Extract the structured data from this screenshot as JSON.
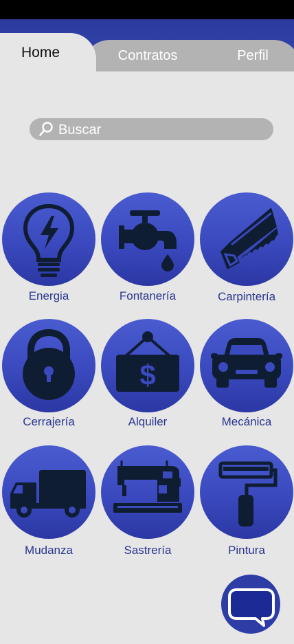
{
  "tabs": [
    {
      "label": "Home",
      "active": true
    },
    {
      "label": "Contratos",
      "active": false
    },
    {
      "label": "Perfil",
      "active": false
    }
  ],
  "search": {
    "placeholder": "Buscar",
    "icon": "search-icon"
  },
  "categories": [
    {
      "label": "Energia",
      "icon": "lightbulb-icon"
    },
    {
      "label": "Fontanería",
      "icon": "faucet-icon"
    },
    {
      "label": "Carpintería",
      "icon": "saw-icon"
    },
    {
      "label": "Cerrajería",
      "icon": "padlock-icon"
    },
    {
      "label": "Alquiler",
      "icon": "rent-sign-icon"
    },
    {
      "label": "Mecánica",
      "icon": "car-icon"
    },
    {
      "label": "Mudanza",
      "icon": "truck-icon"
    },
    {
      "label": "Sastrería",
      "icon": "sewing-machine-icon"
    },
    {
      "label": "Pintura",
      "icon": "paint-roller-icon"
    }
  ],
  "chat": {
    "icon": "chat-bubble-icon"
  },
  "colors": {
    "accent": "#3546b1",
    "icon_dark": "#0f1d33",
    "background": "#e6e6e6",
    "tab_inactive": "#b3b3b3"
  }
}
